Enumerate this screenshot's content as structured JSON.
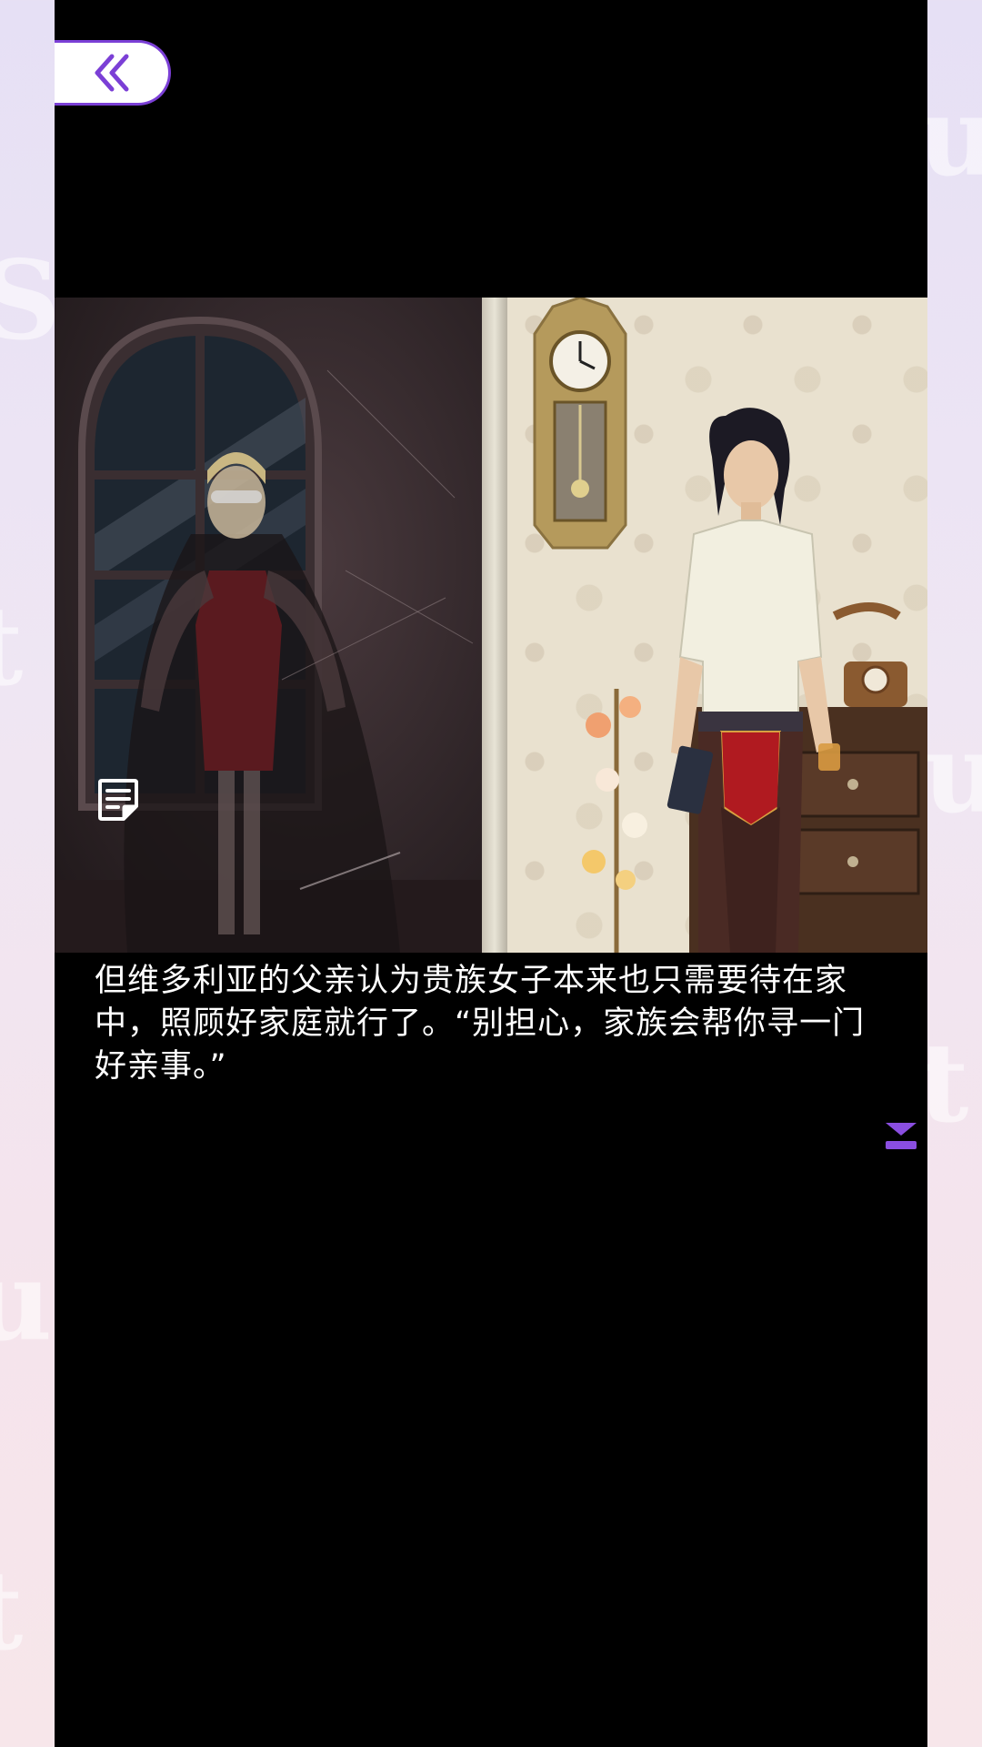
{
  "colors": {
    "accent": "#7b3fd6",
    "stage_background": "#000000",
    "text": "#ffffff",
    "side_background_top": "#e6e0f5",
    "side_background_bottom": "#f7e6ea"
  },
  "icons": {
    "back": "double-chevron-left-icon",
    "log": "dialogue-log-icon",
    "next": "double-chevron-down-icon"
  },
  "dialogue": {
    "text": "但维多利亚的父亲认为贵族女子本来也只需要待在家中，照顾好家庭就行了。“别担心，家族会帮你寻一门好亲事。”"
  }
}
